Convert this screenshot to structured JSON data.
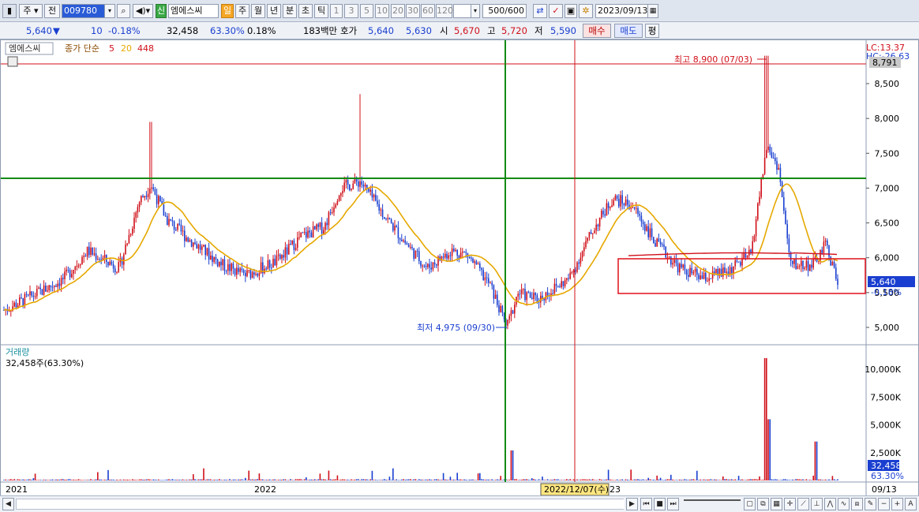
{
  "toolbar": {
    "period_unit": "주",
    "prev_label": "전",
    "code": "009780",
    "new_label": "신",
    "stock_name": "엠에스씨",
    "tf_day": "일",
    "tf_week": "주",
    "tf_month": "월",
    "tf_year": "년",
    "tf_min": "분",
    "tf_sec": "초",
    "tf_tick": "틱",
    "intervals": [
      "1",
      "3",
      "5",
      "10",
      "20",
      "30",
      "60",
      "120"
    ],
    "count": "500",
    "count_total": "/600",
    "date": "2023/09/13"
  },
  "quote": {
    "price": "5,640",
    "arrow": "▼",
    "change": "10",
    "change_pct": "-0.18%",
    "volume": "32,458",
    "vol_ratio": "63.30%",
    "turnover_pct": "0.18%",
    "amount": "183백만",
    "bid_label": "호가",
    "ask": "5,640",
    "bid": "5,630",
    "open_label": "시",
    "open": "5,670",
    "high_label": "고",
    "high": "5,720",
    "low_label": "저",
    "low": "5,590",
    "buy_label": "매수",
    "sell_label": "매도",
    "eval_label": "평"
  },
  "price_pane": {
    "legend_name": "엠에스씨",
    "legend_close": "종가 단순",
    "ma1": "5",
    "ma2": "20",
    "ma3": "448",
    "lc1": "LC:13.37",
    "lc2": "HC:-26.63",
    "y_ticks": [
      "8,500",
      "8,000",
      "7,500",
      "7,000",
      "6,500",
      "6,000",
      "5,500",
      "5,000"
    ],
    "last_price_label": "5,640",
    "last_change_label": "-0.18%",
    "hline_label": "8,791",
    "max_note": "최고 8,900 (07/03)",
    "min_note": "최저 4,975 (09/30)"
  },
  "volume_pane": {
    "title": "거래량",
    "value": "32,458주(63.30%)",
    "y_ticks": [
      "10,000K",
      "7,500K",
      "5,000K",
      "2,500K"
    ],
    "last_label": "32,458",
    "last_pct": "63.30%"
  },
  "x_axis": {
    "labels": [
      "2021",
      "2022",
      "23",
      "09/13"
    ],
    "crosshair_date": "2022/12/07(수)"
  },
  "colors": {
    "up": "#d0101a",
    "down": "#1a3fd0",
    "ma5": "#e6a800",
    "ma448": "#d0101a",
    "green_line": "#138a13",
    "red_box": "#e0101a"
  },
  "chart_data": {
    "type": "candlestick",
    "period": "2021-01 to 2023-09-13",
    "y_range": [
      4700,
      9100
    ],
    "high": {
      "value": 8900,
      "date": "07/03"
    },
    "low": {
      "value": 4975,
      "date": "09/30"
    },
    "last": {
      "close": 5640,
      "change": -10,
      "change_pct": -0.18
    },
    "volume_range": [
      0,
      11000000
    ],
    "volume_last": 32458
  }
}
